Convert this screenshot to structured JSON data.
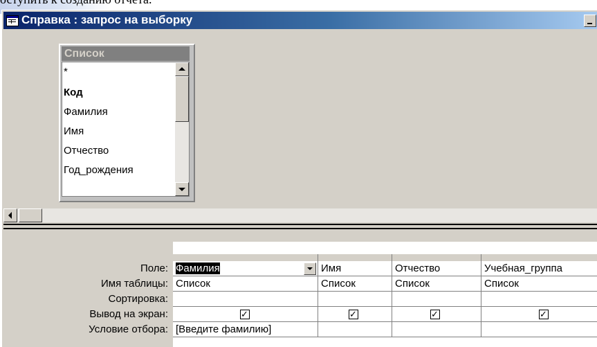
{
  "background_text": "оступить к созданию отчета.",
  "window": {
    "title": "Справка : запрос на выборку"
  },
  "field_list": {
    "title": "Список",
    "items": [
      {
        "label": "*",
        "bold": false
      },
      {
        "label": "Код",
        "bold": true
      },
      {
        "label": "Фамилия",
        "bold": false
      },
      {
        "label": "Имя",
        "bold": false
      },
      {
        "label": "Отчество",
        "bold": false
      },
      {
        "label": "Год_рождения",
        "bold": false
      }
    ]
  },
  "grid": {
    "row_labels": {
      "field": "Поле:",
      "table": "Имя таблицы:",
      "sort": "Сортировка:",
      "show": "Вывод на экран:",
      "criteria": "Условие отбора:"
    },
    "columns": [
      {
        "field": "Фамилия",
        "table": "Список",
        "sort": "",
        "show": true,
        "criteria": "[Введите фамилию]"
      },
      {
        "field": "Имя",
        "table": "Список",
        "sort": "",
        "show": true,
        "criteria": ""
      },
      {
        "field": "Отчество",
        "table": "Список",
        "sort": "",
        "show": true,
        "criteria": ""
      },
      {
        "field": "Учебная_группа",
        "table": "Список",
        "sort": "",
        "show": true,
        "criteria": ""
      }
    ]
  }
}
